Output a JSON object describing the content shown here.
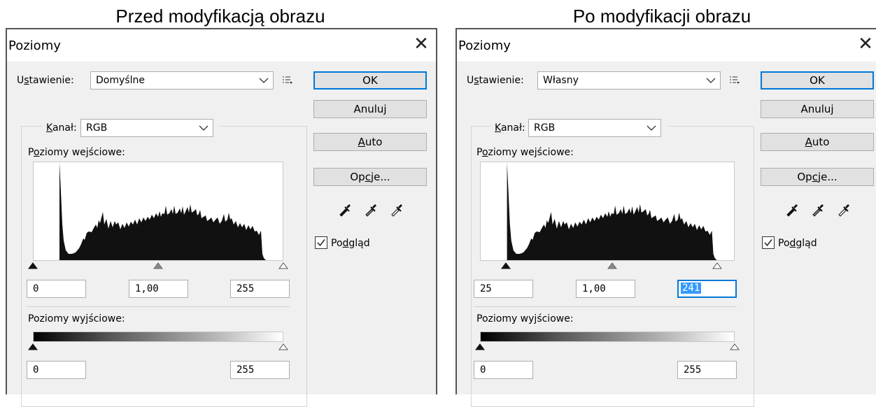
{
  "captions": {
    "before": "Przed modyfikacją obrazu",
    "after": "Po modyfikacji obrazu"
  },
  "dialogs": {
    "before": {
      "title": "Poziomy",
      "preset_label": "Ustawienie:",
      "preset_value": "Domyślne",
      "channel_label": "Kanał:",
      "channel_value": "RGB",
      "input_levels_label": "Poziomy wejściowe:",
      "input_black": "0",
      "input_gamma": "1,00",
      "input_white": "255",
      "output_levels_label": "Poziomy wyjściowe:",
      "output_black": "0",
      "output_white": "255",
      "buttons": {
        "ok": "OK",
        "cancel": "Anuluj",
        "auto": "Auto",
        "options": "Opcje..."
      },
      "preview_label": "Podgląd",
      "preview_checked": true
    },
    "after": {
      "title": "Poziomy",
      "preset_label": "Ustawienie:",
      "preset_value": "Własny",
      "channel_label": "Kanał:",
      "channel_value": "RGB",
      "input_levels_label": "Poziomy wejściowe:",
      "input_black": "25",
      "input_gamma": "1,00",
      "input_white": "241",
      "output_levels_label": "Poziomy wyjściowe:",
      "output_black": "0",
      "output_white": "255",
      "buttons": {
        "ok": "OK",
        "cancel": "Anuluj",
        "auto": "Auto",
        "options": "Opcje..."
      },
      "preview_label": "Podgląd",
      "preview_checked": true
    }
  },
  "colors": {
    "accent": "#0078d7",
    "selection": "#3399ff",
    "dialog_bg": "#f0f0f0"
  }
}
